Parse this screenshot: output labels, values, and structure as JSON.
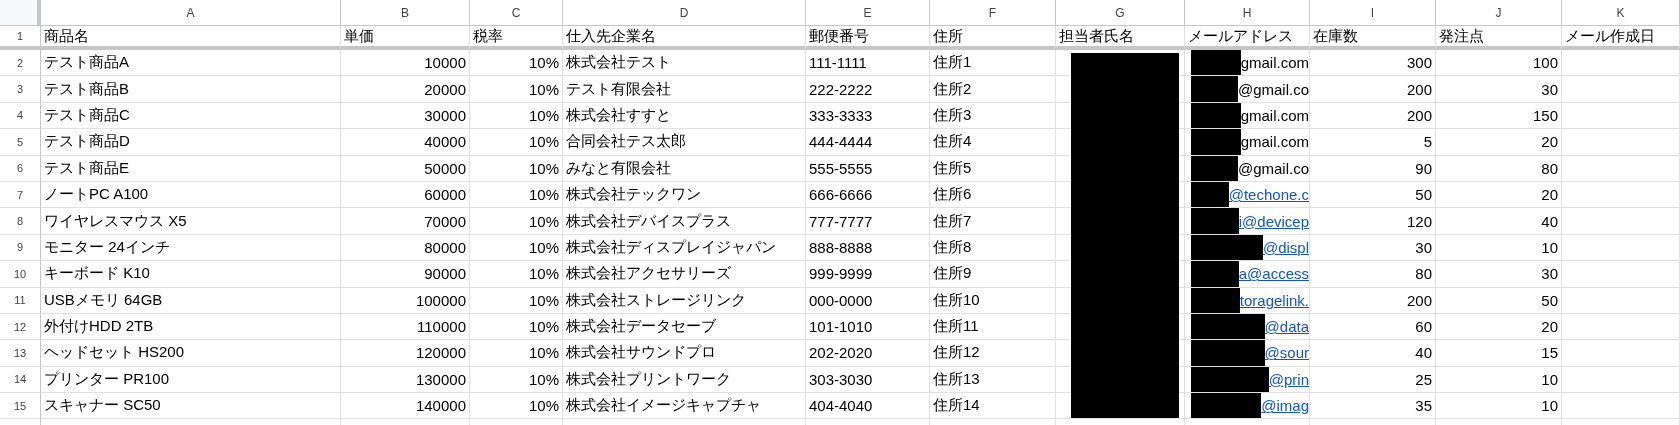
{
  "column_letters": [
    "A",
    "B",
    "C",
    "D",
    "E",
    "F",
    "G",
    "H",
    "I",
    "J",
    "K"
  ],
  "header_row": {
    "number": "1",
    "cells": [
      "商品名",
      "単価",
      "税率",
      "仕入先企業名",
      "郵便番号",
      "住所",
      "担当者氏名",
      "メールアドレス",
      "在庫数",
      "発注点",
      "メール作成日"
    ]
  },
  "rows": [
    {
      "number": "2",
      "name": "テスト商品A",
      "price": "10000",
      "tax": "10%",
      "supplier": "株式会社テスト",
      "zip": "111-1111",
      "address": "住所1",
      "email": "gmail.com",
      "email_link": false,
      "stock": "300",
      "reorder": "100"
    },
    {
      "number": "3",
      "name": "テスト商品B",
      "price": "20000",
      "tax": "10%",
      "supplier": "テスト有限会社",
      "zip": "222-2222",
      "address": "住所2",
      "email": "@gmail.co",
      "email_link": false,
      "stock": "200",
      "reorder": "30"
    },
    {
      "number": "4",
      "name": "テスト商品C",
      "price": "30000",
      "tax": "10%",
      "supplier": "株式会社すすと",
      "zip": "333-3333",
      "address": "住所3",
      "email": "gmail.com",
      "email_link": false,
      "stock": "200",
      "reorder": "150"
    },
    {
      "number": "5",
      "name": "テスト商品D",
      "price": "40000",
      "tax": "10%",
      "supplier": "合同会社テス太郎",
      "zip": "444-4444",
      "address": "住所4",
      "email": "gmail.com",
      "email_link": false,
      "stock": "5",
      "reorder": "20"
    },
    {
      "number": "6",
      "name": "テスト商品E",
      "price": "50000",
      "tax": "10%",
      "supplier": "みなと有限会社",
      "zip": "555-5555",
      "address": "住所5",
      "email": "@gmail.co",
      "email_link": false,
      "stock": "90",
      "reorder": "80"
    },
    {
      "number": "7",
      "name": "ノートPC A100",
      "price": "60000",
      "tax": "10%",
      "supplier": "株式会社テックワン",
      "zip": "666-6666",
      "address": "住所6",
      "email": "@techone.c",
      "email_link": true,
      "stock": "50",
      "reorder": "20"
    },
    {
      "number": "8",
      "name": "ワイヤレスマウス X5",
      "price": "70000",
      "tax": "10%",
      "supplier": "株式会社デバイスプラス",
      "zip": "777-7777",
      "address": "住所7",
      "email": "i@devicep",
      "email_link": true,
      "stock": "120",
      "reorder": "40"
    },
    {
      "number": "9",
      "name": "モニター 24インチ",
      "price": "80000",
      "tax": "10%",
      "supplier": "株式会社ディスプレイジャパン",
      "zip": "888-8888",
      "address": "住所8",
      "email": "@displ",
      "email_link": true,
      "stock": "30",
      "reorder": "10"
    },
    {
      "number": "10",
      "name": "キーボード K10",
      "price": "90000",
      "tax": "10%",
      "supplier": "株式会社アクセサリーズ",
      "zip": "999-9999",
      "address": "住所9",
      "email": "a@access",
      "email_link": true,
      "stock": "80",
      "reorder": "30"
    },
    {
      "number": "11",
      "name": "USBメモリ 64GB",
      "price": "100000",
      "tax": "10%",
      "supplier": "株式会社ストレージリンク",
      "zip": "000-0000",
      "address": "住所10",
      "email": "toragelink.",
      "email_link": true,
      "stock": "200",
      "reorder": "50"
    },
    {
      "number": "12",
      "name": "外付けHDD 2TB",
      "price": "110000",
      "tax": "10%",
      "supplier": "株式会社データセーブ",
      "zip": "101-1010",
      "address": "住所11",
      "email": "@data",
      "email_link": true,
      "stock": "60",
      "reorder": "20"
    },
    {
      "number": "13",
      "name": "ヘッドセット HS200",
      "price": "120000",
      "tax": "10%",
      "supplier": "株式会社サウンドプロ",
      "zip": "202-2020",
      "address": "住所12",
      "email": "@sour",
      "email_link": true,
      "stock": "40",
      "reorder": "15"
    },
    {
      "number": "14",
      "name": "プリンター PR100",
      "price": "130000",
      "tax": "10%",
      "supplier": "株式会社プリントワーク",
      "zip": "303-3030",
      "address": "住所13",
      "email": "@prin",
      "email_link": true,
      "stock": "25",
      "reorder": "10"
    },
    {
      "number": "15",
      "name": "スキャナー SC50",
      "price": "140000",
      "tax": "10%",
      "supplier": "株式会社イメージキャプチャ",
      "zip": "404-4040",
      "address": "住所14",
      "email": "@imag",
      "email_link": true,
      "stock": "35",
      "reorder": "10"
    }
  ]
}
